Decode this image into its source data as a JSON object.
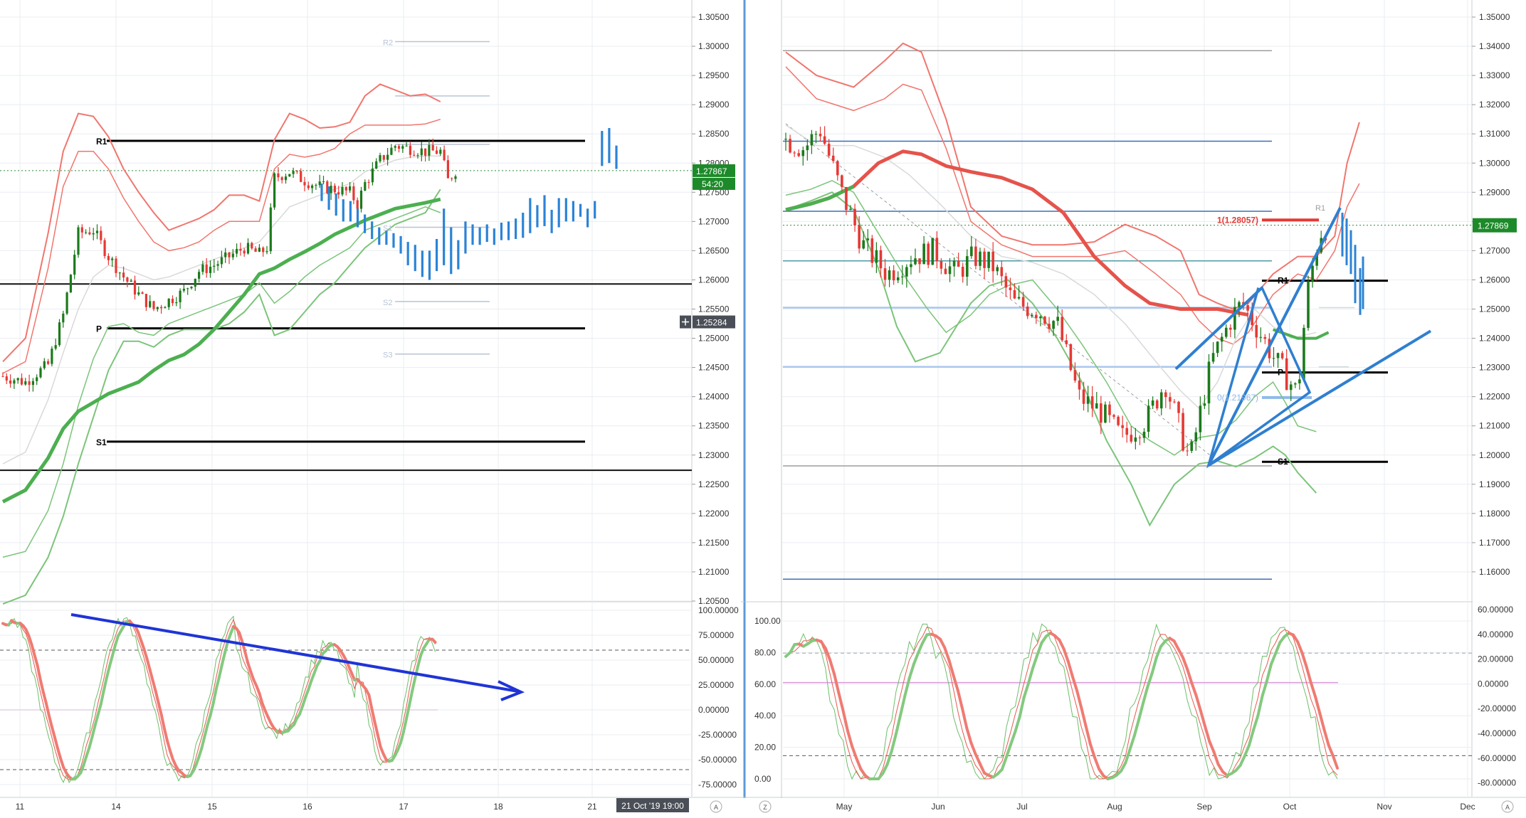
{
  "colors": {
    "up": "#1b7a1b",
    "down": "#e53935",
    "bb_red": "#f0766e",
    "bb_green": "#7cc47a",
    "ma_green": "#4caf50",
    "ma_red": "#e5534b",
    "proj_blue": "#2b83d6",
    "trend_blue": "#2f7fd0",
    "arrow_blue": "#1f34d6",
    "pivot_black": "#000000",
    "last_price_bg": "#1d8a2a",
    "grid": "#e9edf2",
    "axis_text": "#333333",
    "level_fade": "#b8c4d4",
    "fib_red": "#e53935",
    "fib_blue": "#8fb9ea"
  },
  "left_panel": {
    "price_axis_ticks": [
      "1.30500",
      "1.30000",
      "1.29500",
      "1.29000",
      "1.28500",
      "1.28000",
      "1.27500",
      "1.27000",
      "1.26500",
      "1.26000",
      "1.25500",
      "1.25000",
      "1.24500",
      "1.24000",
      "1.23500",
      "1.23000",
      "1.22500",
      "1.22000",
      "1.21500",
      "1.21000",
      "1.20500"
    ],
    "last_price": "1.27867",
    "countdown": "54:20",
    "crosshair_price": "1.25284",
    "pivot_labels": {
      "r1": "R1",
      "p": "P",
      "s1": "S1"
    },
    "faded_labels": {
      "r2": "R2",
      "s1": "S1",
      "s2": "S2",
      "s3": "S3"
    },
    "time_axis": [
      "11",
      "14",
      "15",
      "16",
      "17",
      "18",
      "21"
    ],
    "crosshair_time": "21 Oct '19  19:00",
    "corner_label": "A",
    "osc_ticks": [
      "100.00000",
      "75.00000",
      "50.00000",
      "25.00000",
      "0.00000",
      "-25.00000",
      "-50.00000",
      "-75.00000"
    ]
  },
  "right_panel": {
    "price_axis_ticks": [
      "1.35000",
      "1.34000",
      "1.33000",
      "1.32000",
      "1.31000",
      "1.30000",
      "1.29000",
      "1.28000",
      "1.27000",
      "1.26000",
      "1.25000",
      "1.24000",
      "1.23000",
      "1.22000",
      "1.21000",
      "1.20000",
      "1.19000",
      "1.18000",
      "1.17000",
      "1.16000"
    ],
    "last_price": "1.27869",
    "fib_labels": {
      "top": "1(1.28057)",
      "bottom": "0(1.21967)"
    },
    "pivot_labels": {
      "r1": "R1",
      "p": "P",
      "s1": "S1",
      "r1_faded": "R1"
    },
    "time_axis": [
      "May",
      "Jun",
      "Jul",
      "Aug",
      "Sep",
      "Oct",
      "Nov",
      "Dec"
    ],
    "corner_left": "Z",
    "corner_right": "A",
    "osc_left_ticks": [
      "100.00",
      "80.00",
      "60.00",
      "40.00",
      "20.00",
      "0.00"
    ],
    "osc_right_ticks": [
      "60.00000",
      "40.00000",
      "20.00000",
      "0.00000",
      "-20.00000",
      "-40.00000",
      "-60.00000",
      "-80.00000"
    ]
  },
  "chart_data": [
    {
      "type": "candlestick",
      "panel": "left",
      "timeframe": "hourly",
      "x_labels": [
        "11",
        "14",
        "15",
        "16",
        "17",
        "18",
        "21"
      ],
      "ylim": [
        1.203,
        1.308
      ],
      "grid": true,
      "close_path": [
        {
          "x": 0,
          "y": 1.2435
        },
        {
          "x": 3,
          "y": 1.2425
        },
        {
          "x": 6,
          "y": 1.2455
        },
        {
          "x": 8,
          "y": 1.254
        },
        {
          "x": 10,
          "y": 1.268
        },
        {
          "x": 12,
          "y": 1.2685
        },
        {
          "x": 14,
          "y": 1.264
        },
        {
          "x": 16,
          "y": 1.2605
        },
        {
          "x": 18,
          "y": 1.2575
        },
        {
          "x": 20,
          "y": 1.255
        },
        {
          "x": 22,
          "y": 1.2565
        },
        {
          "x": 24,
          "y": 1.258
        },
        {
          "x": 26,
          "y": 1.2615
        },
        {
          "x": 28,
          "y": 1.2625
        },
        {
          "x": 30,
          "y": 1.264
        },
        {
          "x": 32,
          "y": 1.2655
        },
        {
          "x": 34,
          "y": 1.2645
        },
        {
          "x": 35,
          "y": 1.2655
        },
        {
          "x": 36,
          "y": 1.2775
        },
        {
          "x": 38,
          "y": 1.2785
        },
        {
          "x": 40,
          "y": 1.277
        },
        {
          "x": 42,
          "y": 1.276
        },
        {
          "x": 44,
          "y": 1.2755
        },
        {
          "x": 46,
          "y": 1.275
        },
        {
          "x": 47,
          "y": 1.273
        },
        {
          "x": 48,
          "y": 1.2765
        },
        {
          "x": 50,
          "y": 1.2805
        },
        {
          "x": 52,
          "y": 1.283
        },
        {
          "x": 54,
          "y": 1.2825
        },
        {
          "x": 56,
          "y": 1.282
        },
        {
          "x": 58,
          "y": 1.282
        },
        {
          "x": 59,
          "y": 1.277
        },
        {
          "x": 60,
          "y": 1.2787
        }
      ],
      "pivot_levels": {
        "R1": 1.2838,
        "P": 1.2517,
        "S1": 1.2323
      },
      "horizontal_lines": [
        1.2593,
        1.2274
      ],
      "projection_bars": {
        "start_x": 60,
        "end_x": 86,
        "range": [
          1.2605,
          1.2855
        ],
        "final": 1.2787
      },
      "oscillator": {
        "ylim": [
          -85,
          105
        ],
        "levels": [
          60,
          0,
          -60
        ],
        "trend_line_from": 90,
        "trend_line_to": 22
      }
    },
    {
      "type": "candlestick",
      "panel": "right",
      "timeframe": "daily",
      "x_labels": [
        "May",
        "Jun",
        "Jul",
        "Aug",
        "Sep",
        "Oct",
        "Nov",
        "Dec"
      ],
      "ylim": [
        1.155,
        1.356
      ],
      "grid": true,
      "close_path": [
        {
          "x": "Apr 25",
          "y": 1.308
        },
        {
          "x": "May 1",
          "y": 1.305
        },
        {
          "x": "May 6",
          "y": 1.312
        },
        {
          "x": "May 13",
          "y": 1.29
        },
        {
          "x": "May 20",
          "y": 1.272
        },
        {
          "x": "May 28",
          "y": 1.262
        },
        {
          "x": "Jun 5",
          "y": 1.268
        },
        {
          "x": "Jun 12",
          "y": 1.27
        },
        {
          "x": "Jun 19",
          "y": 1.262
        },
        {
          "x": "Jun 25",
          "y": 1.268
        },
        {
          "x": "Jul 1",
          "y": 1.265
        },
        {
          "x": "Jul 8",
          "y": 1.252
        },
        {
          "x": "Jul 15",
          "y": 1.25
        },
        {
          "x": "Jul 22",
          "y": 1.245
        },
        {
          "x": "Jul 29",
          "y": 1.22
        },
        {
          "x": "Aug 5",
          "y": 1.215
        },
        {
          "x": "Aug 12",
          "y": 1.206
        },
        {
          "x": "Aug 20",
          "y": 1.212
        },
        {
          "x": "Aug 26",
          "y": 1.225
        },
        {
          "x": "Sep 3",
          "y": 1.198
        },
        {
          "x": "Sep 10",
          "y": 1.232
        },
        {
          "x": "Sep 17",
          "y": 1.248
        },
        {
          "x": "Sep 20",
          "y": 1.252
        },
        {
          "x": "Sep 24",
          "y": 1.245
        },
        {
          "x": "Oct 1",
          "y": 1.232
        },
        {
          "x": "Oct 8",
          "y": 1.221
        },
        {
          "x": "Oct 11",
          "y": 1.255
        },
        {
          "x": "Oct 15",
          "y": 1.276
        },
        {
          "x": "Oct 18",
          "y": 1.2787
        }
      ],
      "fib_levels": {
        "1": 1.28057,
        "0": 1.21967
      },
      "pivot_levels": {
        "R1": 1.2597,
        "P": 1.2283,
        "S1": 1.1977
      },
      "horizontal_lines": [
        1.3385,
        1.3075,
        1.2835,
        1.2665,
        1.2505,
        1.2302,
        1.1963,
        1.1575
      ],
      "oscillator": {
        "left_ylim": [
          -5,
          106
        ],
        "right_ylim": [
          -90,
          62
        ],
        "levels": [
          25,
          -58,
          1
        ]
      }
    }
  ]
}
